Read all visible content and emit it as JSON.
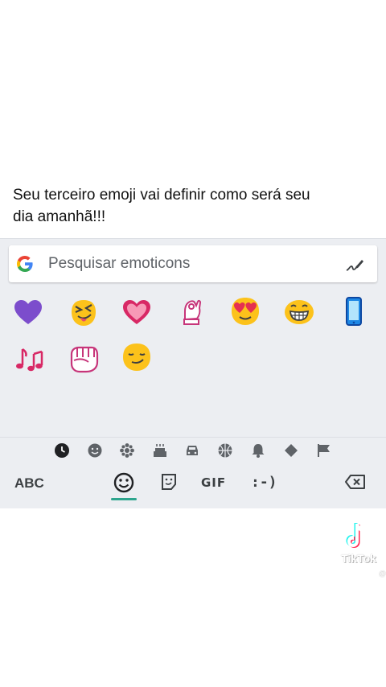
{
  "caption": {
    "line1": "Seu terceiro emoji vai definir como será seu",
    "line2": "dia amanhã!!!"
  },
  "search": {
    "placeholder": "Pesquisar emoticons",
    "logo_icon": "google-g-icon",
    "handwriting_icon": "pen-icon"
  },
  "emojis": [
    {
      "name": "purple-heart-icon"
    },
    {
      "name": "squinting-tongue-face-icon"
    },
    {
      "name": "pink-heart-icon"
    },
    {
      "name": "ok-hand-icon"
    },
    {
      "name": "heart-eyes-face-icon"
    },
    {
      "name": "grinning-face-icon"
    },
    {
      "name": "mobile-phone-icon"
    },
    {
      "name": "music-notes-icon"
    },
    {
      "name": "fist-icon"
    },
    {
      "name": "smirking-face-icon"
    }
  ],
  "categories": [
    {
      "name": "recent-icon",
      "active": true
    },
    {
      "name": "smileys-icon"
    },
    {
      "name": "nature-icon"
    },
    {
      "name": "food-icon"
    },
    {
      "name": "travel-icon"
    },
    {
      "name": "activity-icon"
    },
    {
      "name": "objects-icon"
    },
    {
      "name": "symbols-icon"
    },
    {
      "name": "flags-icon"
    }
  ],
  "toolbar": {
    "abc_label": "ABC",
    "gif_label": "GIF",
    "emoticon_label": ":-)"
  },
  "watermark": {
    "brand": "TikTok",
    "handle": "@"
  },
  "colors": {
    "keyboard_bg": "#eceef2",
    "accent": "#2ea58e",
    "icon_dark": "#3c4043"
  }
}
